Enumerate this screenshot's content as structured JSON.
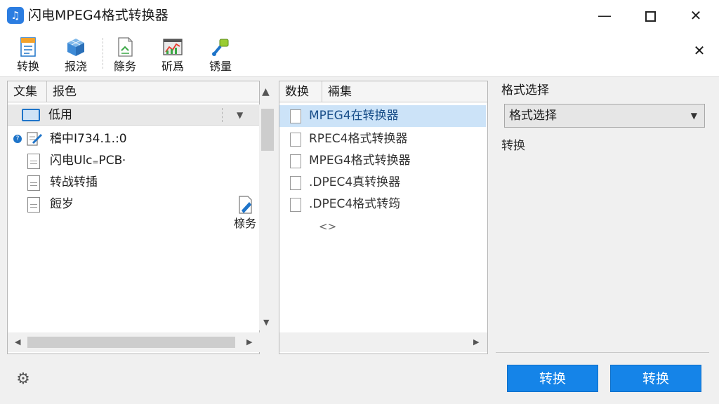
{
  "window": {
    "title": "闪电MPEG4格式转换器",
    "icon": "music-note-icon",
    "minimize": "—",
    "close": "✕"
  },
  "toolbar": {
    "items": [
      {
        "label": "转换",
        "icon": "convert-file-icon"
      },
      {
        "label": "报浇",
        "icon": "cube-icon"
      },
      {
        "label": "篨务",
        "icon": "document-icon"
      },
      {
        "label": "斫爲",
        "icon": "chart-window-icon"
      },
      {
        "label": "锈量",
        "icon": "paint-tool-icon"
      }
    ],
    "close": "✕"
  },
  "left_panel": {
    "col1": "文集",
    "col2": "报色",
    "folder": "低用",
    "files": [
      {
        "label": "稽中I734.1.:0",
        "icon": "edit-file-icon",
        "info": true
      },
      {
        "label": "闪电Ulc₌PCB⸱",
        "icon": "file-icon",
        "info": false
      },
      {
        "label": "转战转插",
        "icon": "file-icon",
        "info": false
      },
      {
        "label": "餖岁",
        "icon": "file-icon",
        "info": false
      }
    ],
    "float_item": {
      "label": "榇务",
      "icon": "blue-file-icon"
    }
  },
  "mid_panel": {
    "col1": "数换",
    "col2": "裲集",
    "formats": [
      {
        "label": "MPEG4在转换器",
        "selected": true
      },
      {
        "label": "RPEC4格式转换器",
        "selected": false
      },
      {
        "label": "MPEG4格式转换器",
        "selected": false
      },
      {
        "label": ".DPEC4真转换器",
        "selected": false
      },
      {
        "label": ".DPEC4格式转筠",
        "selected": false
      }
    ],
    "ellipsis": "<>"
  },
  "right_panel": {
    "group_label": "格式选择",
    "select_value": "格式选择",
    "convert_label": "转换"
  },
  "bottom": {
    "settings_icon": "gear-icon",
    "button1": "转换",
    "button2": "转换"
  },
  "colors": {
    "accent": "#1584e8",
    "selected_row": "#cce3f8"
  }
}
